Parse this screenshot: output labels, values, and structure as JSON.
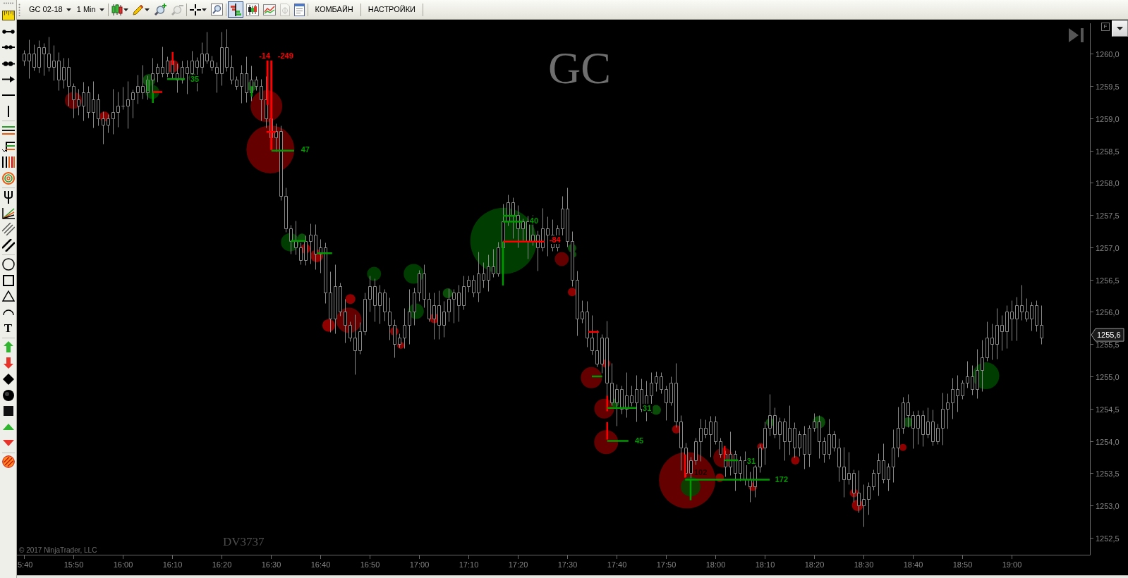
{
  "drawing_toolbar": {
    "groups": [
      [
        {
          "kind": "ruler"
        },
        {
          "kind": "line"
        },
        {
          "kind": "extended-line"
        },
        {
          "kind": "ray"
        },
        {
          "kind": "arrow-line"
        },
        {
          "kind": "horizontal-line"
        },
        {
          "kind": "vertical-line"
        }
      ],
      [
        {
          "kind": "fib-retracement"
        },
        {
          "kind": "fib-extension"
        },
        {
          "kind": "fib-time"
        },
        {
          "kind": "fib-circle"
        }
      ],
      [
        {
          "kind": "pitchfork"
        },
        {
          "kind": "gann-fan"
        },
        {
          "kind": "regression-channel"
        },
        {
          "kind": "trend-channel"
        }
      ],
      [
        {
          "kind": "ellipse"
        },
        {
          "kind": "rectangle"
        },
        {
          "kind": "triangle"
        },
        {
          "kind": "arc"
        },
        {
          "kind": "text",
          "glyph": "T"
        }
      ],
      [
        {
          "kind": "arrow-up"
        },
        {
          "kind": "arrow-down"
        },
        {
          "kind": "diamond"
        },
        {
          "kind": "dot"
        },
        {
          "kind": "square"
        },
        {
          "kind": "triangle-up"
        },
        {
          "kind": "triangle-down"
        }
      ],
      [
        {
          "kind": "region"
        }
      ]
    ]
  },
  "toolbar": {
    "groups": [
      [
        {
          "kind": "dropdown",
          "label": "GC 02-18"
        },
        {
          "kind": "dropdown",
          "label": "1 Min"
        }
      ],
      [
        {
          "kind": "chart-style",
          "menu": true,
          "disabled": false,
          "pressed": false
        },
        {
          "kind": "draw",
          "menu": true,
          "disabled": false,
          "pressed": false
        },
        {
          "kind": "zoom-in",
          "menu": false,
          "disabled": false,
          "pressed": false
        },
        {
          "kind": "zoom-out",
          "menu": false,
          "disabled": true,
          "pressed": false
        }
      ],
      [
        {
          "kind": "crosshair",
          "menu": true,
          "disabled": false,
          "pressed": false
        },
        {
          "kind": "find",
          "menu": false,
          "disabled": false,
          "pressed": false
        }
      ],
      [
        {
          "kind": "data-box",
          "menu": false,
          "disabled": false,
          "pressed": true
        },
        {
          "kind": "candles",
          "menu": false,
          "disabled": false,
          "pressed": false
        },
        {
          "kind": "indicators",
          "menu": false,
          "disabled": false,
          "pressed": false
        },
        {
          "kind": "strategies",
          "menu": false,
          "disabled": true,
          "pressed": false
        },
        {
          "kind": "properties",
          "menu": false,
          "disabled": false,
          "pressed": false
        }
      ],
      [
        {
          "kind": "text",
          "label": "КОМБАЙН"
        }
      ],
      [
        {
          "kind": "text",
          "label": "НАСТРОЙКИ"
        }
      ]
    ]
  },
  "chart": {
    "flag": "F",
    "instrument_label": "GC",
    "level_labels": [
      {
        "text": "35",
        "color": "#009900"
      },
      {
        "text": "-14",
        "color": "#ff0000"
      },
      {
        "text": "-249",
        "color": "#ff0000"
      },
      {
        "text": "47",
        "color": "#009900"
      },
      {
        "text": "40",
        "color": "#009900"
      },
      {
        "text": "-84",
        "color": "#ff0000"
      },
      {
        "text": "31",
        "color": "#009900"
      },
      {
        "text": "45",
        "color": "#009900"
      },
      {
        "text": "102",
        "color": "#1a0000"
      },
      {
        "text": "31",
        "color": "#009900"
      },
      {
        "text": "172",
        "color": "#009900"
      }
    ],
    "price_axis": {
      "labels": [
        "1260,0",
        "1259,5",
        "1259,0",
        "1258,5",
        "1258,0",
        "1257,5",
        "1257,0",
        "1256,5",
        "1256,0",
        "1255,5",
        "1255,0",
        "1254,5",
        "1254,0",
        "1253,5",
        "1253,0",
        "1252,5"
      ]
    },
    "last_price": "1255,6",
    "text_label": "DV3737",
    "copyright": "© 2017 NinjaTrader, LLC",
    "time_axis": {
      "labels": [
        "5:40",
        "15:50",
        "16:00",
        "16:10",
        "16:20",
        "16:30",
        "16:40",
        "16:50",
        "17:00",
        "17:10",
        "17:20",
        "17:30",
        "17:40",
        "17:50",
        "18:00",
        "18:10",
        "18:20",
        "18:30",
        "18:40",
        "18:50",
        "19:00"
      ]
    }
  }
}
